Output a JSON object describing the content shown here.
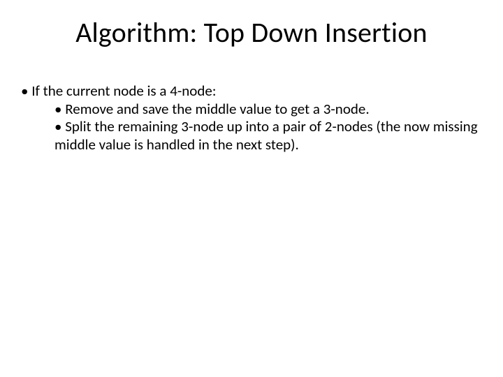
{
  "slide": {
    "title": "Algorithm: Top Down Insertion",
    "bullets": {
      "l1": "If the current node is a 4-node:",
      "l2a": "Remove and save the middle value to get a 3-node.",
      "l2b": "Split the remaining 3-node up into a pair of 2-nodes (the now missing middle value is handled in the next step)."
    },
    "bullet_char": "•"
  }
}
